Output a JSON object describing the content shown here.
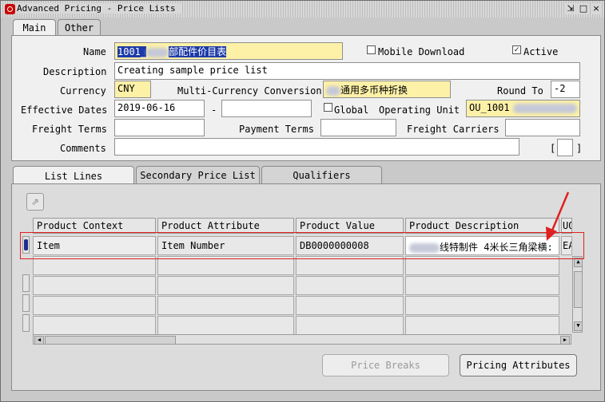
{
  "window": {
    "title": "Advanced Pricing - Price Lists",
    "buttons": [
      "⇲",
      "□",
      "×"
    ]
  },
  "tabs": [
    {
      "label": "Main",
      "active": true
    },
    {
      "label": "Other",
      "active": false
    }
  ],
  "form": {
    "name_label": "Name",
    "name_value": "1001_",
    "name_value_suffix": "部配件价目表",
    "mobile_download_label": "Mobile Download",
    "mobile_download_checked": false,
    "active_label": "Active",
    "active_checked": true,
    "description_label": "Description",
    "description_value": "Creating sample price list",
    "currency_label": "Currency",
    "currency_value": "CNY",
    "multi_currency_label": "Multi-Currency Conversion",
    "multi_currency_value": "通用多币种折换",
    "round_to_label": "Round To",
    "round_to_value": "-2",
    "effective_dates_label": "Effective Dates",
    "effective_from": "2019-06-16",
    "effective_to": "",
    "date_separator": "-",
    "global_label": "Global",
    "global_checked": false,
    "operating_unit_label": "Operating Unit",
    "operating_unit_value": "OU_1001",
    "freight_terms_label": "Freight Terms",
    "freight_terms_value": "",
    "payment_terms_label": "Payment Terms",
    "payment_terms_value": "",
    "freight_carriers_label": "Freight Carriers",
    "freight_carriers_value": "",
    "comments_label": "Comments",
    "comments_value": "",
    "dff_left": "[",
    "dff_right": "]"
  },
  "lower_tabs": [
    {
      "label": "List Lines",
      "active": true
    },
    {
      "label": "Secondary Price List",
      "active": false
    },
    {
      "label": "Qualifiers",
      "active": false
    }
  ],
  "grid": {
    "headers": [
      "Product Context",
      "Product Attribute",
      "Product Value",
      "Product Description",
      "UO"
    ],
    "rows": [
      {
        "context": "Item",
        "attribute": "Item Number",
        "value": "DB0000000008",
        "description": "线特制件 4米长三角梁横:",
        "uom": "EA"
      }
    ]
  },
  "buttons": {
    "price_breaks": "Price Breaks",
    "pricing_attributes": "Pricing Attributes"
  },
  "colors": {
    "annotation_red": "#e02020",
    "required_field": "#fdf1a8",
    "selection": "#1c3aa8"
  }
}
